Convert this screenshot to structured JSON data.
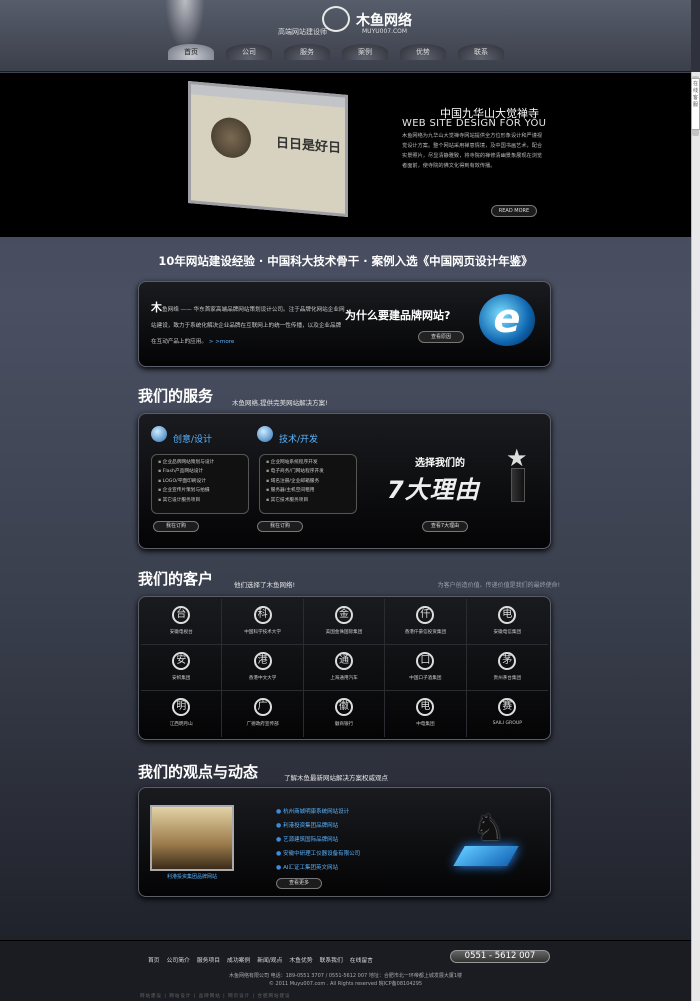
{
  "header": {
    "logo_text": "木鱼网络",
    "logo_tm": "™",
    "logo_sub": "MUYU007.COM",
    "tagline": "高端网站建设师",
    "nav": [
      "首页",
      "公司",
      "服务",
      "案例",
      "优势",
      "联系"
    ]
  },
  "side_tab": "在线客服",
  "banner": {
    "title": "中国九华山大觉禅寺",
    "subtitle": "WEB SITE DESIGN FOR YOU",
    "desc": "木鱼网络为九华山大觉禅寺网站提供全方位形象设计和严谨视觉设计方案。整个网站采用禅意情境，及中国书画艺术，配合实景照片，尽显清静雅致，将寺院的禅修清幽景象展现在浏览者面前，使寺院的佛文化得到有效传播。",
    "more": "READ MORE",
    "screen_word": "日日是好日"
  },
  "headline": "10年网站建设经验 · 中国科大技术骨干 · 案例入选《中国网页设计年鉴》",
  "intro": {
    "lead": "木",
    "text": "鱼网络 —— 华东首家高端品牌网站策划设计公司。注于品牌化网站企业网站建设，致力于系统化解决企业品牌在互联网上的统一性传播，以及企业品牌在互动产品上的应用。",
    "more": "> >more",
    "question": "为什么要建品牌网站?",
    "button": "查看原因"
  },
  "services": {
    "title": "我们的服务",
    "subtitle": "木鱼网络,提供完美网站解决方案!",
    "col1": {
      "head": "创意/设计",
      "items": [
        "企业品牌网站策划与设计",
        "Flash产品网站设计",
        "LOGO/平面印刷设计",
        "企业宣传片策划与拍摄",
        "其它设计服务项目"
      ],
      "button": "我在订购"
    },
    "col2": {
      "head": "技术/开发",
      "items": [
        "企业网站系统程序开发",
        "电子商务/门网站程序开发",
        "域名注册/企业邮箱服务",
        "服务器/主机空间租用",
        "其它技术服务项目"
      ],
      "button": "我在订购"
    },
    "choose": "选择我们的",
    "seven": "7大理由",
    "seven_button": "查看7大理由"
  },
  "clients": {
    "title": "我们的客户",
    "subtitle": "他们选择了木鱼网络!",
    "right_note": "为客户创造价值、传递价值是我们的最终使命!",
    "items": [
      {
        "name": "安徽电视台",
        "glyph": "台"
      },
      {
        "name": "中国科学技术大学",
        "glyph": "科"
      },
      {
        "name": "美国金侏国际集团",
        "glyph": "金"
      },
      {
        "name": "香港仟豪信投资集团",
        "glyph": "仟"
      },
      {
        "name": "安徽电信集团",
        "glyph": "电"
      },
      {
        "name": "安帜集团",
        "glyph": "安"
      },
      {
        "name": "香港中文大学",
        "glyph": "港"
      },
      {
        "name": "上海通用汽车",
        "glyph": "通"
      },
      {
        "name": "中国口子酒集团",
        "glyph": "口"
      },
      {
        "name": "贵州茅台集团",
        "glyph": "茅"
      },
      {
        "name": "江西明月山",
        "glyph": "明"
      },
      {
        "name": "广德政府宣传部",
        "glyph": "广"
      },
      {
        "name": "徽商银行",
        "glyph": "徽"
      },
      {
        "name": "中电集团",
        "glyph": "电"
      },
      {
        "name": "SAILI GROUP",
        "glyph": "赛"
      }
    ]
  },
  "news": {
    "title": "我们的观点与动态",
    "subtitle": "了解木鱼最新网站解决方案权威观点",
    "image_caption": "利港投资集团品牌网站",
    "items": [
      "杭州商城明康系统网站设计",
      "利港投资集团品牌网站",
      "艺源建筑国际品牌网站",
      "安徽中研理工仪器设备有限公司",
      "AI汇证工集团英文网站"
    ],
    "button": "查看更多"
  },
  "footer": {
    "nav": [
      "首页",
      "公司简介",
      "服务项目",
      "成功案例",
      "新闻/观点",
      "木鱼优势",
      "联系我们",
      "在线留言"
    ],
    "phone": "0551 - 5612 007",
    "info1": "木鱼网络有限公司  电话：189-0551 3707 / 0551-5612 007  地址：合肥市北一环帝都上城发展大厦1楼",
    "info2": "© 2011 Muyu007.com . All Rights reserved  皖ICP备08104295",
    "links": "网站建设 | 网站设计 | 品牌网站 | 网页设计 | 合肥网站建设"
  }
}
